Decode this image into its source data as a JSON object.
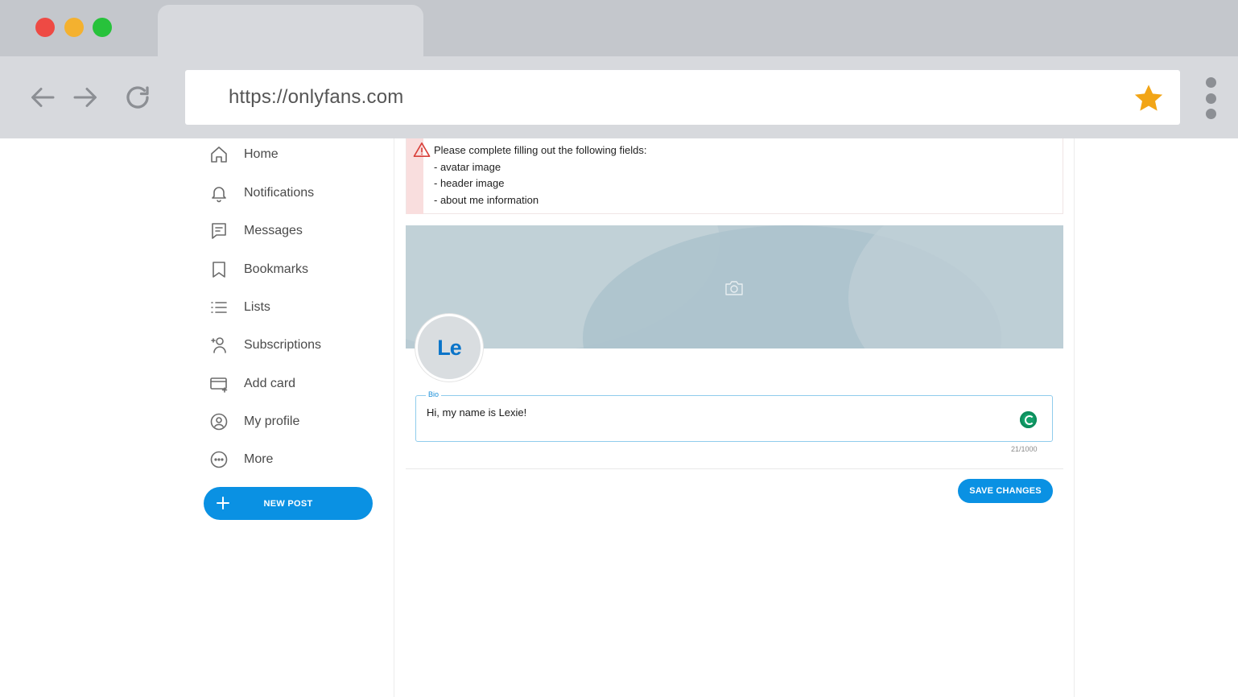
{
  "browser": {
    "url": "https://onlyfans.com"
  },
  "sidebar": {
    "items": [
      {
        "label": "Home",
        "icon": "home-icon"
      },
      {
        "label": "Notifications",
        "icon": "bell-icon"
      },
      {
        "label": "Messages",
        "icon": "message-icon"
      },
      {
        "label": "Bookmarks",
        "icon": "bookmark-icon"
      },
      {
        "label": "Lists",
        "icon": "list-icon"
      },
      {
        "label": "Subscriptions",
        "icon": "subscriptions-icon"
      },
      {
        "label": "Add card",
        "icon": "card-icon"
      },
      {
        "label": "My profile",
        "icon": "profile-icon"
      },
      {
        "label": "More",
        "icon": "more-icon"
      }
    ],
    "new_post_label": "NEW POST"
  },
  "alert": {
    "title": "Please complete filling out the following fields:",
    "fields": [
      "- avatar image",
      "- header image",
      "- about me information"
    ]
  },
  "profile": {
    "avatar_initials": "Le"
  },
  "bio": {
    "label": "Bio",
    "value": "Hi, my name is Lexie!",
    "counter": "21/1000"
  },
  "actions": {
    "save_label": "SAVE CHANGES"
  },
  "colors": {
    "accent": "#0a91e3",
    "alert_bar": "#f9dede",
    "banner": "#b7cad3"
  }
}
